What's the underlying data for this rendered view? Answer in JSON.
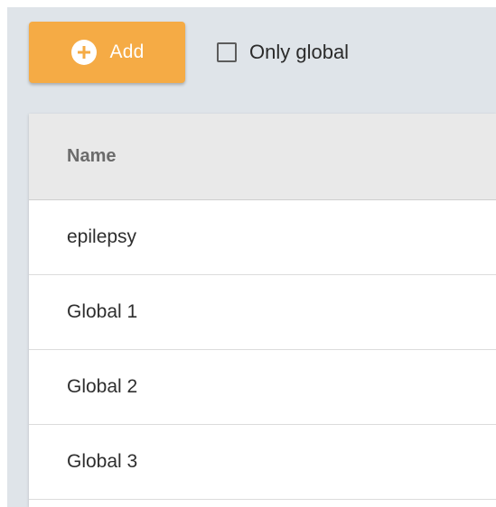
{
  "toolbar": {
    "add_button": {
      "label": "Add",
      "icon": "plus-circle-icon",
      "color": "#f5ab45"
    },
    "only_global": {
      "label": "Only global",
      "checked": false
    }
  },
  "table": {
    "columns": [
      "Name"
    ],
    "rows": [
      {
        "name": "epilepsy"
      },
      {
        "name": "Global 1"
      },
      {
        "name": "Global 2"
      },
      {
        "name": "Global 3"
      }
    ]
  }
}
